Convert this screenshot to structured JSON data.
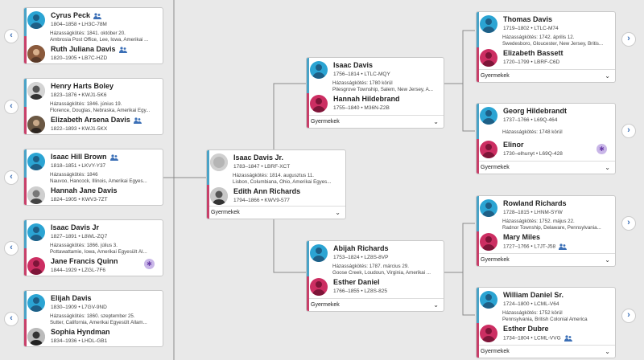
{
  "ui": {
    "children_label": "Gyermekek",
    "nav_left": "‹",
    "nav_right": "›",
    "chevron": "⌄"
  },
  "colors": {
    "male": "#2ba4d3",
    "female": "#cc2e62",
    "link": "#3b6fb6"
  },
  "left": [
    {
      "husband": {
        "name": "Cyrus Peck",
        "dates": "1804–1858 • LH3C-78M",
        "people_icon": true
      },
      "marriage": [
        "Házasságkötés: 1841. október 20.",
        "Ambrosia Post Office, Lee, Iowa, Amerikai ..."
      ],
      "wife": {
        "name": "Ruth Juliana Davis",
        "dates": "1820–1905 • LB7C-HZD",
        "people_icon": true
      }
    },
    {
      "husband": {
        "name": "Henry Harts Boley",
        "dates": "1823–1876 • KWJ1-5K6"
      },
      "marriage": [
        "Házasságkötés: 1846. június 19.",
        "Florence, Douglas, Nebraska, Amerikai Egy..."
      ],
      "wife": {
        "name": "Elizabeth Arsena Davis",
        "dates": "1822–1893 • KWJ1-5KX",
        "people_icon": true
      }
    },
    {
      "husband": {
        "name": "Isaac Hill Brown",
        "dates": "1818–1851 • LKVY-Y37",
        "people_icon": true
      },
      "marriage": [
        "Házasságkötés: 1846",
        "Nauvoo, Hancock, Illinois, Amerikai Egyes..."
      ],
      "wife": {
        "name": "Hannah Jane Davis",
        "dates": "1824–1905 • KWV3-7ZT"
      }
    },
    {
      "husband": {
        "name": "Isaac Davis Jr",
        "dates": "1827–1891 • L8WL-ZQ7"
      },
      "marriage": [
        "Házasságkötés: 1866. július 3.",
        "Pottawattamie, Iowa, Amerikai Egyesült Ál..."
      ],
      "wife": {
        "name": "Jane Francis Quinn",
        "dates": "1844–1929 • LZGL-7F6",
        "badge": true
      }
    },
    {
      "husband": {
        "name": "Elijah Davis",
        "dates": "1830–1909 • L7GV-9ND"
      },
      "marriage": [
        "Házasságkötés: 1860. szeptember 25.",
        "Sutter, California, Amerikai Egyesült Állam..."
      ],
      "wife": {
        "name": "Sophia Hyndman",
        "dates": "1834–1936 • LHDL-GB1"
      }
    }
  ],
  "center": {
    "husband": {
      "name": "Isaac Davis Jr.",
      "dates": "1783–1847 • LBRF-XCT"
    },
    "marriage": [
      "Házasságkötés: 1814. augusztus 11.",
      "Lisbon, Columbiana, Ohio, Amerikai Egyes..."
    ],
    "wife": {
      "name": "Edith Ann Richards",
      "dates": "1794–1866 • KWV9-577"
    }
  },
  "parents": [
    {
      "husband": {
        "name": "Isaac Davis",
        "dates": "1756–1814 • LTLC-MQY"
      },
      "marriage": [
        "Házasságkötés: 1780 körül",
        "Pilesgrove Township, Salem, New Jersey, A..."
      ],
      "wife": {
        "name": "Hannah Hildebrand",
        "dates": "1755–1840 • M36N-Z2B"
      }
    },
    {
      "husband": {
        "name": "Abijah Richards",
        "dates": "1753–1824 • LZ8S-8VP"
      },
      "marriage": [
        "Házasságkötés: 1787. március 29.",
        "Goose Creek, Loudoun, Virginia, Amerikai ..."
      ],
      "wife": {
        "name": "Esther Daniel",
        "dates": "1766–1855 • LZ8S-825"
      }
    }
  ],
  "grandparents": [
    {
      "husband": {
        "name": "Thomas Davis",
        "dates": "1719–1802 • LTLC-M74"
      },
      "marriage": [
        "Házasságkötés: 1742. április 12.",
        "Swedesboro, Gloucester, New Jersey, Britis..."
      ],
      "wife": {
        "name": "Elizabeth Bassett",
        "dates": "1720–1799 • LBRF-C6D"
      }
    },
    {
      "husband": {
        "name": "Georg Hildebrandt",
        "dates": "1737–1766 • L69Q-464"
      },
      "marriage": [
        "Házasságkötés: 1748 körül",
        ""
      ],
      "wife": {
        "name": "Elinor",
        "dates": "1730–elhunyt • L69Q-428",
        "badge": true
      }
    },
    {
      "husband": {
        "name": "Rowland Richards",
        "dates": "1728–1815 • LHNM-SYW"
      },
      "marriage": [
        "Házasságkötés: 1752. május 22.",
        "Radnor Township, Delaware, Pennsylvania..."
      ],
      "wife": {
        "name": "Mary Miles",
        "dates": "1727–1766 • L7JT-J58",
        "people_icon": true
      }
    },
    {
      "husband": {
        "name": "William Daniel Sr.",
        "dates": "1724–1800 • LCML-V64"
      },
      "marriage": [
        "Házasságkötés: 1752 körül",
        "Pennsylvania, British Colonial America"
      ],
      "wife": {
        "name": "Esther Dubre",
        "dates": "1734–1804 • LCML-VVG",
        "people_icon": true
      }
    }
  ]
}
